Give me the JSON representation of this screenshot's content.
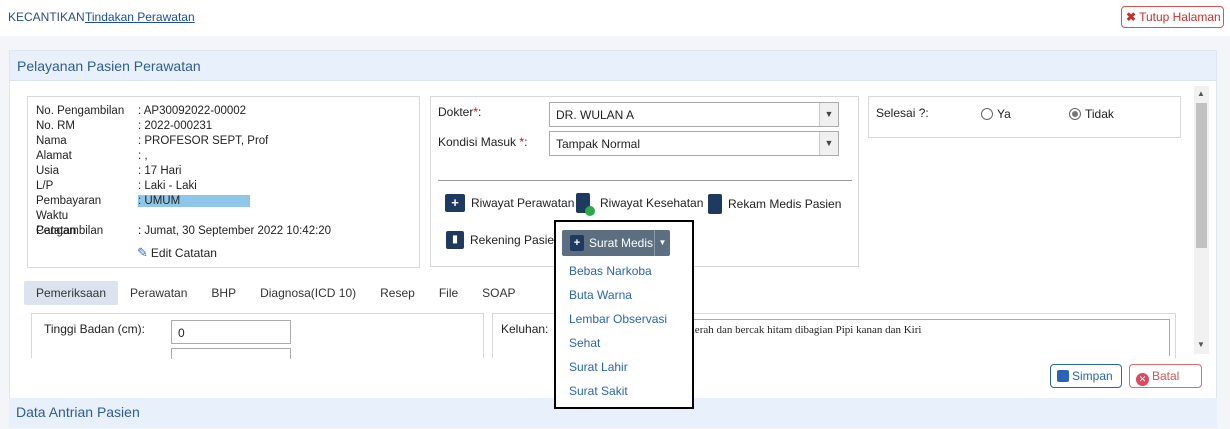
{
  "breadcrumb": {
    "root": "KECANTIKAN",
    "current": "Tindakan Perawatan"
  },
  "close_button": {
    "icon": "close-icon",
    "label": "Tutup Halaman"
  },
  "panel": {
    "title": "Pelayanan Pasien Perawatan"
  },
  "patient": {
    "rows": [
      {
        "k": "No. Pengambilan",
        "v": ": AP30092022-00002"
      },
      {
        "k": "No. RM",
        "v": ": 2022-000231"
      },
      {
        "k": "Nama",
        "v": ": PROFESOR SEPT, Prof"
      },
      {
        "k": "Alamat",
        "v": ": ,"
      },
      {
        "k": "Usia",
        "v": ": 17 Hari"
      },
      {
        "k": "L/P",
        "v": ": Laki - Laki"
      },
      {
        "k": "Pembayaran",
        "v": ": UMUM"
      },
      {
        "k": "Waktu Pengambilan",
        "v": ": Jumat, 30 September 2022 10:42:20"
      },
      {
        "k": "Catatan",
        "v": ":"
      }
    ],
    "edit_note": "Edit Catatan"
  },
  "form": {
    "dokter_label": "Dokter",
    "dokter_value": "DR. WULAN A",
    "kondisi_label": "Kondisi Masuk",
    "kondisi_value": "Tampak Normal",
    "required_mark": "*",
    "colon": ":"
  },
  "actions": {
    "riwayat_perawatan": "Riwayat Perawatan",
    "riwayat_kesehatan": "Riwayat Kesehatan",
    "rekam_medis": "Rekam Medis Pasien",
    "rekening": "Rekening Pasien",
    "surat_medis": "Surat Medis"
  },
  "dropdown": {
    "items": [
      "Bebas Narkoba",
      "Buta Warna",
      "Lembar Observasi",
      "Sehat",
      "Surat Lahir",
      "Surat Sakit"
    ]
  },
  "selesai": {
    "label": "Selesai ?:",
    "ya": "Ya",
    "tidak": "Tidak",
    "selected": "Tidak"
  },
  "tabs": [
    "Pemeriksaan",
    "Perawatan",
    "BHP",
    "Diagnosa(ICD 10)",
    "Resep",
    "File",
    "SOAP"
  ],
  "active_tab": "Pemeriksaan",
  "exam": {
    "tinggi_label": "Tinggi Badan (cm):",
    "tinggi_value": "0",
    "keluhan_label": "Keluhan:",
    "keluhan_value": "n merah dan bercak hitam dibagian Pipi kanan dan Kiri"
  },
  "buttons": {
    "simpan": "Simpan",
    "batal": "Batal"
  },
  "section2": {
    "title": "Data Antrian Pasien"
  },
  "colors": {
    "accent": "#2f5d95",
    "link": "#2a63b8",
    "danger": "#c9302c",
    "dark_icon": "#1e3a5f",
    "highlight": "#8ec7ea"
  }
}
